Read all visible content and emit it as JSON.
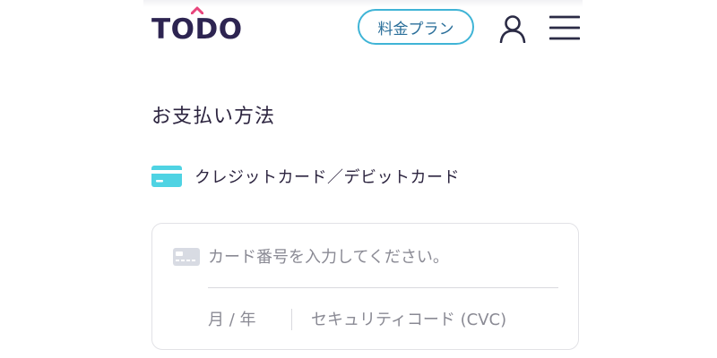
{
  "header": {
    "logo_text": "TODO",
    "plan_button_label": "料金プラン",
    "user_icon": "user-icon",
    "menu_icon": "hamburger-menu-icon"
  },
  "payment": {
    "title": "お支払い方法",
    "method": {
      "icon": "credit-card-icon",
      "label": "クレジットカード／デビットカード"
    },
    "form": {
      "card_number": {
        "value": "",
        "placeholder": "カード番号を入力してください。"
      },
      "expiry": {
        "value": "",
        "placeholder": "月 / 年"
      },
      "cvc": {
        "value": "",
        "placeholder": "セキュリティコード (CVC)"
      }
    }
  },
  "colors": {
    "logo": "#2d2451",
    "logo_accent": "#e8457c",
    "plan_button_border": "#3fb4d6",
    "card_icon": "#4fd3e3",
    "placeholder": "#8a8a94"
  }
}
